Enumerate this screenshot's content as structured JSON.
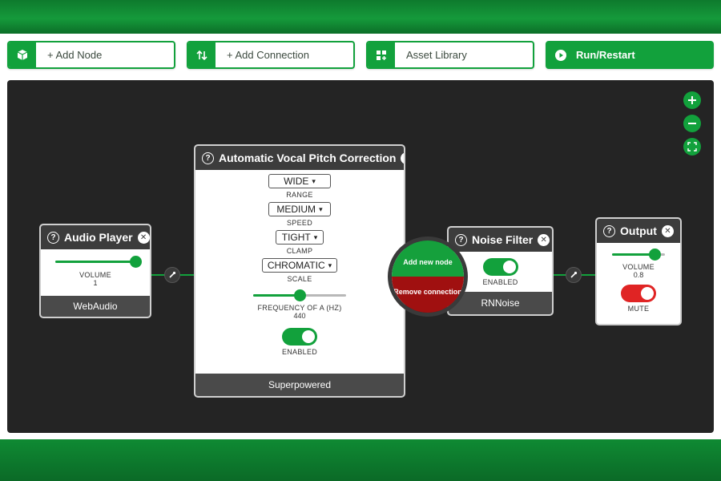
{
  "toolbar": {
    "add_node": "+ Add Node",
    "add_connection": "+ Add Connection",
    "asset_library": "Asset Library",
    "run_restart": "Run/Restart"
  },
  "nodes": {
    "audio_player": {
      "title": "Audio Player",
      "volume_label": "VOLUME",
      "volume_value": "1",
      "volume_level": 1.0,
      "footer": "WebAudio"
    },
    "pitch": {
      "title": "Automatic Vocal Pitch Correction",
      "range_value": "WIDE",
      "range_label": "RANGE",
      "speed_value": "MEDIUM",
      "speed_label": "SPEED",
      "clamp_value": "TIGHT",
      "clamp_label": "CLAMP",
      "scale_value": "CHROMATIC",
      "scale_label": "SCALE",
      "freq_label": "FREQUENCY OF A (HZ)",
      "freq_value": "440",
      "freq_level": 0.5,
      "enabled_label": "ENABLED",
      "footer": "Superpowered"
    },
    "noise_filter": {
      "title": "Noise Filter",
      "enabled_label": "ENABLED",
      "footer": "RNNoise"
    },
    "output": {
      "title": "Output",
      "volume_label": "VOLUME",
      "volume_value": "0.8",
      "volume_level": 0.8,
      "mute_label": "MUTE"
    }
  },
  "radial_menu": {
    "add_new_node": "Add new node",
    "remove_connection": "Remove connection"
  },
  "colors": {
    "accent": "#12a13c",
    "canvas": "#242424",
    "danger": "#e02424",
    "node_header": "#3c3c3c"
  }
}
